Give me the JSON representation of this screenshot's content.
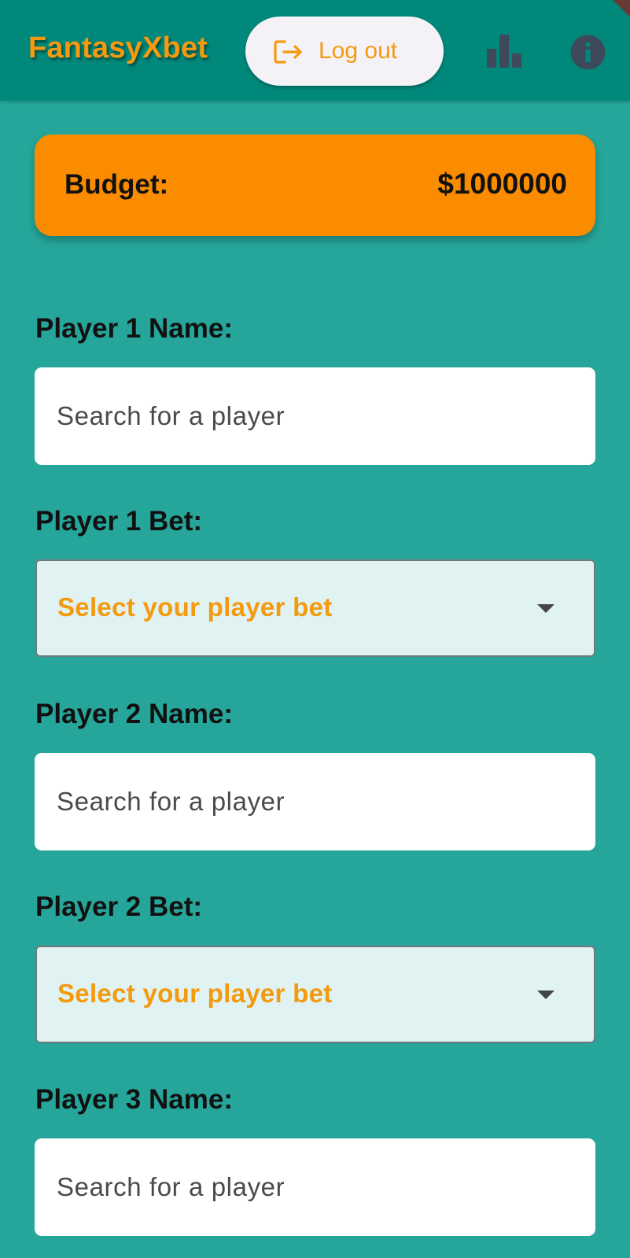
{
  "appbar": {
    "title": "FantasyXbet",
    "logout_label": "Log out",
    "icons": {
      "logout": "logout-icon",
      "leaderboard": "bar-chart-icon",
      "info": "info-icon"
    }
  },
  "budget": {
    "label": "Budget:",
    "value": "$1000000"
  },
  "form": {
    "player1": {
      "name_label": "Player 1 Name:",
      "name_placeholder": "Search for a player",
      "bet_label": "Player 1 Bet:",
      "bet_placeholder": "Select your player bet"
    },
    "player2": {
      "name_label": "Player 2 Name:",
      "name_placeholder": "Search for a player",
      "bet_label": "Player 2 Bet:",
      "bet_placeholder": "Select your player bet"
    },
    "player3": {
      "name_label": "Player 3 Name:",
      "name_placeholder": "Search for a player"
    }
  },
  "colors": {
    "background": "#26A69A",
    "appbar": "#00897B",
    "accent": "#F59A0E",
    "budget_card": "#FB8C00",
    "dropdown_bg": "#E0F2F1"
  }
}
